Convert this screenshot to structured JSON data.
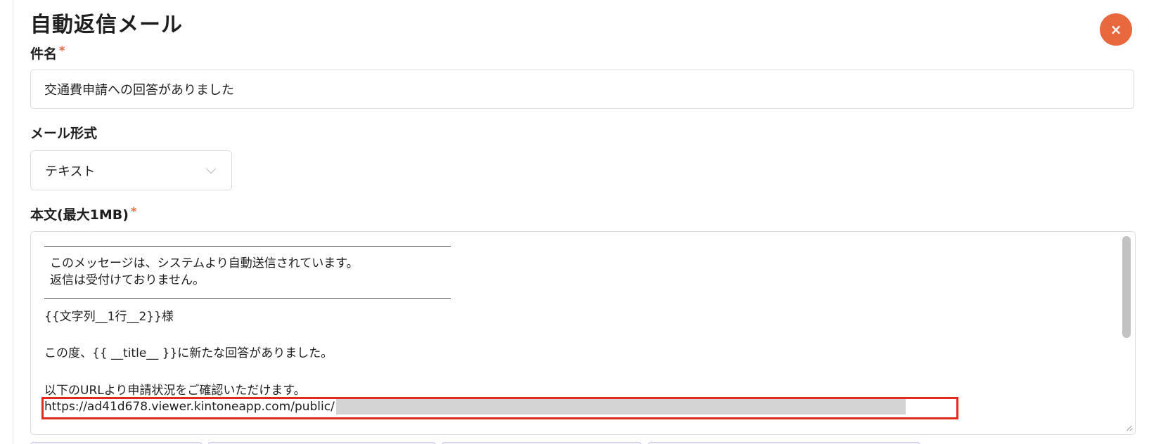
{
  "dialog": {
    "title": "自動返信メール",
    "close_icon": "close-icon",
    "close_glyph": "×",
    "accent_color": "#e8673c"
  },
  "subject": {
    "label": "件名",
    "required_mark": "*",
    "value": "交通費申請への回答がありました"
  },
  "mail_format": {
    "label": "メール形式",
    "selected": "テキスト",
    "chevron_icon": "chevron-down-icon"
  },
  "body": {
    "label": "本文(最大1MB)",
    "required_mark": "*",
    "lines": {
      "notice_1": "このメッセージは、システムより自動送信されています。",
      "notice_2": "返信は受付けておりません。",
      "greeting": "{{文字列__1行__2}}様",
      "announcement": "この度、{{ __title__ }}に新たな回答がありました。",
      "url_intro": "以下のURLより申請状況をご確認いただけます。",
      "url": "https://ad41d678.viewer.kintoneapp.com/public/"
    },
    "highlight_color": "#e02a1f"
  }
}
